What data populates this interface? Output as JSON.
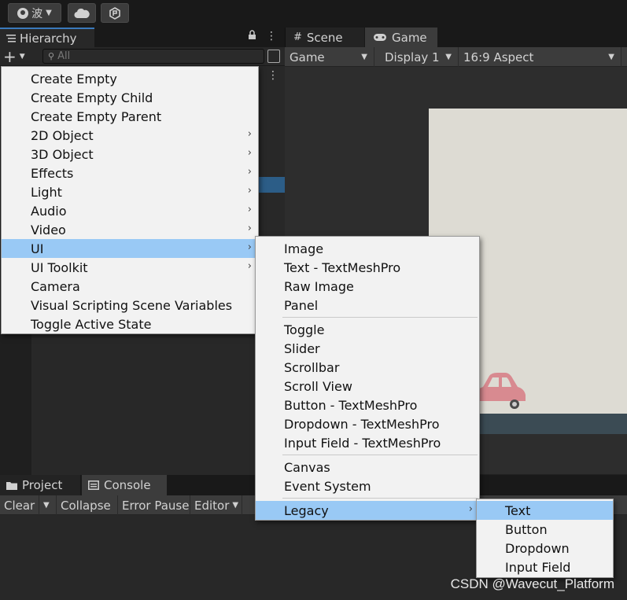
{
  "toolbar": {
    "account_label": "波",
    "account_icon": "account-icon",
    "cloud_icon": "cloud-icon",
    "collab_icon": "collab-icon"
  },
  "hierarchy": {
    "tab_label": "Hierarchy",
    "search_placeholder": "All"
  },
  "scene_game": {
    "tabs": [
      {
        "label": "Scene",
        "icon": "grid-icon"
      },
      {
        "label": "Game",
        "icon": "gamepad-icon"
      }
    ],
    "game_dropdown": "Game",
    "display_dropdown": "Display 1",
    "aspect_dropdown": "16:9 Aspect"
  },
  "console": {
    "tabs": [
      {
        "label": "Project",
        "icon": "folder-icon"
      },
      {
        "label": "Console",
        "icon": "console-icon"
      }
    ],
    "buttons": {
      "clear": "Clear",
      "collapse": "Collapse",
      "error_pause": "Error Pause",
      "editor": "Editor"
    }
  },
  "menu_main": {
    "items": [
      {
        "label": "Create Empty",
        "submenu": false
      },
      {
        "label": "Create Empty Child",
        "submenu": false
      },
      {
        "label": "Create Empty Parent",
        "submenu": false
      },
      {
        "label": "2D Object",
        "submenu": true
      },
      {
        "label": "3D Object",
        "submenu": true
      },
      {
        "label": "Effects",
        "submenu": true
      },
      {
        "label": "Light",
        "submenu": true
      },
      {
        "label": "Audio",
        "submenu": true
      },
      {
        "label": "Video",
        "submenu": true
      },
      {
        "label": "UI",
        "submenu": true,
        "selected": true
      },
      {
        "label": "UI Toolkit",
        "submenu": true
      },
      {
        "label": "Camera",
        "submenu": false
      },
      {
        "label": "Visual Scripting Scene Variables",
        "submenu": false
      },
      {
        "label": "Toggle Active State",
        "submenu": false
      }
    ]
  },
  "menu_ui": {
    "groups": [
      [
        "Image",
        "Text - TextMeshPro",
        "Raw Image",
        "Panel"
      ],
      [
        "Toggle",
        "Slider",
        "Scrollbar",
        "Scroll View",
        "Button - TextMeshPro",
        "Dropdown - TextMeshPro",
        "Input Field - TextMeshPro"
      ],
      [
        "Canvas",
        "Event System"
      ],
      [
        "Legacy"
      ]
    ],
    "selected": "Legacy"
  },
  "menu_legacy": {
    "items": [
      "Text",
      "Button",
      "Dropdown",
      "Input Field"
    ],
    "selected": "Text"
  },
  "watermark": "CSDN @Wavecut_Platform",
  "colors": {
    "menu_bg": "#f2f2f2",
    "menu_selected": "#99c9f5",
    "panel_bg": "#282828",
    "tab_accent": "#3a79bb",
    "game_canvas": "#dddbd3",
    "car": "#d88a90"
  }
}
